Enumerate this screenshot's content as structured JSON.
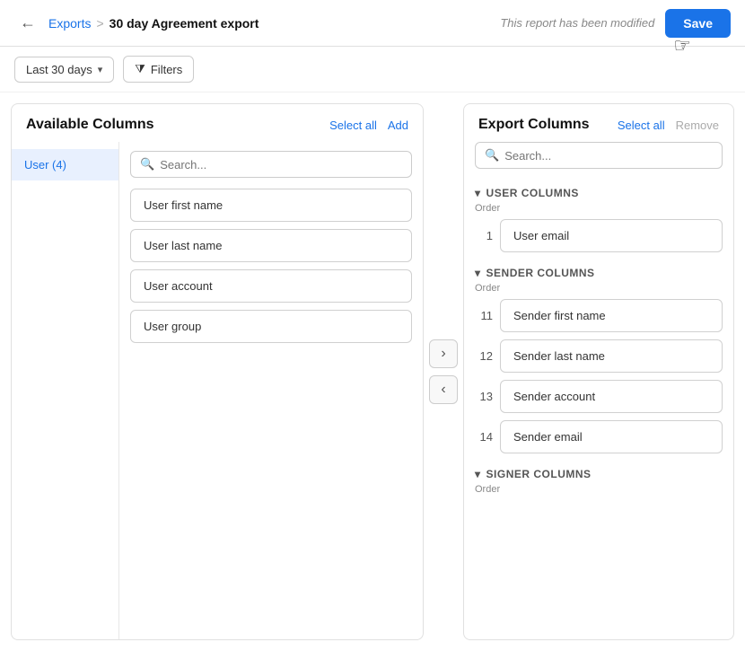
{
  "header": {
    "back_label": "←",
    "breadcrumb_parent": "Exports",
    "breadcrumb_sep": ">",
    "breadcrumb_current": "30 day Agreement export",
    "modified_text": "This report has been modified",
    "save_label": "Save"
  },
  "toolbar": {
    "date_range": "Last 30 days",
    "filters_label": "Filters"
  },
  "available_panel": {
    "title": "Available Columns",
    "select_all_label": "Select all",
    "add_label": "Add",
    "category": "User (4)",
    "search_placeholder": "Search...",
    "columns": [
      {
        "label": "User first name"
      },
      {
        "label": "User last name"
      },
      {
        "label": "User account"
      },
      {
        "label": "User group"
      }
    ]
  },
  "transfer": {
    "forward": "›",
    "backward": "‹"
  },
  "export_panel": {
    "title": "Export Columns",
    "select_all_label": "Select all",
    "remove_label": "Remove",
    "search_placeholder": "Search...",
    "sections": [
      {
        "name": "USER COLUMNS",
        "order_label": "Order",
        "rows": [
          {
            "order": "1",
            "label": "User email"
          }
        ]
      },
      {
        "name": "SENDER COLUMNS",
        "order_label": "Order",
        "rows": [
          {
            "order": "11",
            "label": "Sender first name"
          },
          {
            "order": "12",
            "label": "Sender last name"
          },
          {
            "order": "13",
            "label": "Sender account"
          },
          {
            "order": "14",
            "label": "Sender email"
          }
        ]
      },
      {
        "name": "SIGNER COLUMNS",
        "order_label": "Order",
        "rows": []
      }
    ]
  }
}
